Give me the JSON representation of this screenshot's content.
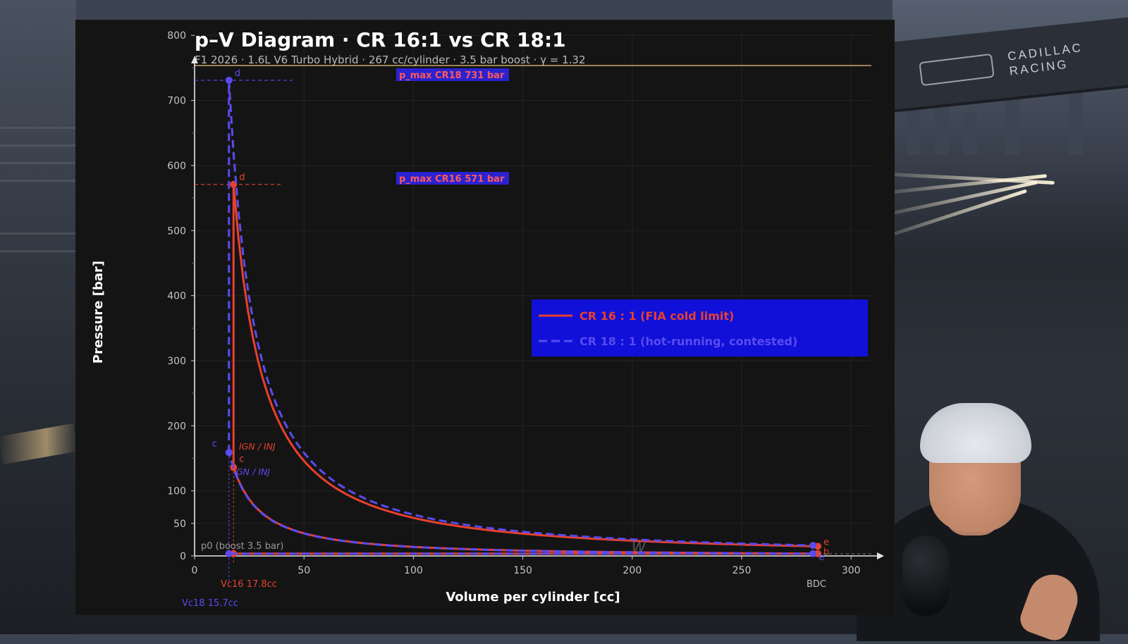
{
  "chart_data": {
    "type": "line",
    "title": "p–V Diagram  ·  CR 16:1 vs CR 18:1",
    "subtitle": "F1 2026 · 1.6L V6 Turbo Hybrid · 267 cc/cylinder · 3.5 bar boost · γ = 1.32",
    "xlabel": "Volume per cylinder  [cc]",
    "ylabel": "Pressure  [bar]",
    "xlim": [
      0,
      310
    ],
    "ylim": [
      0,
      800
    ],
    "x_ticks": [
      "0",
      "50",
      "100",
      "150",
      "200",
      "250",
      "300"
    ],
    "y_ticks": [
      "0",
      "50",
      "100",
      "200",
      "300",
      "400",
      "500",
      "600",
      "700",
      "800"
    ],
    "bdc_label": "BDC",
    "boost_label": "p0  (boost 3.5 bar)",
    "work_label": "W",
    "grid": true,
    "legend_position": "center-right",
    "series": [
      {
        "name": "CR 16 : 1  (FIA cold limit)",
        "color": "#e8402e",
        "dash": "solid",
        "vc": 17.8,
        "vbdc": 284.8,
        "p_c": 136,
        "p_max": 571,
        "p_e": 21.8,
        "p_b": 3.5,
        "p_max_label": "p_max CR16  571 bar",
        "vc_label": "Vc16  17.8cc",
        "ign_label": "IGN / INJ",
        "point_labels": [
          "c",
          "d",
          "e",
          "b"
        ]
      },
      {
        "name": "CR 18 : 1  (hot-running, contested)",
        "color": "#5a4bf0",
        "dash": "dashed",
        "vc": 15.7,
        "vbdc": 282.6,
        "p_c": 159,
        "p_max": 731,
        "p_e": 16.5,
        "p_b": 3.5,
        "p_max_label": "p_max CR18  731 bar",
        "vc_label": "Vc18  15.7cc",
        "ign_label": "GN / INJ",
        "point_labels": [
          "c",
          "d",
          "e"
        ]
      }
    ],
    "gamma": 1.32
  },
  "background": {
    "sign_text": "CADILLAC RACING"
  },
  "colors": {
    "panel": "#141414",
    "legend_bg": "#1010d8",
    "badge_bg": "#2a22d0",
    "badge_text": "#ff5a5a",
    "guide_line": "#c9a86a"
  }
}
